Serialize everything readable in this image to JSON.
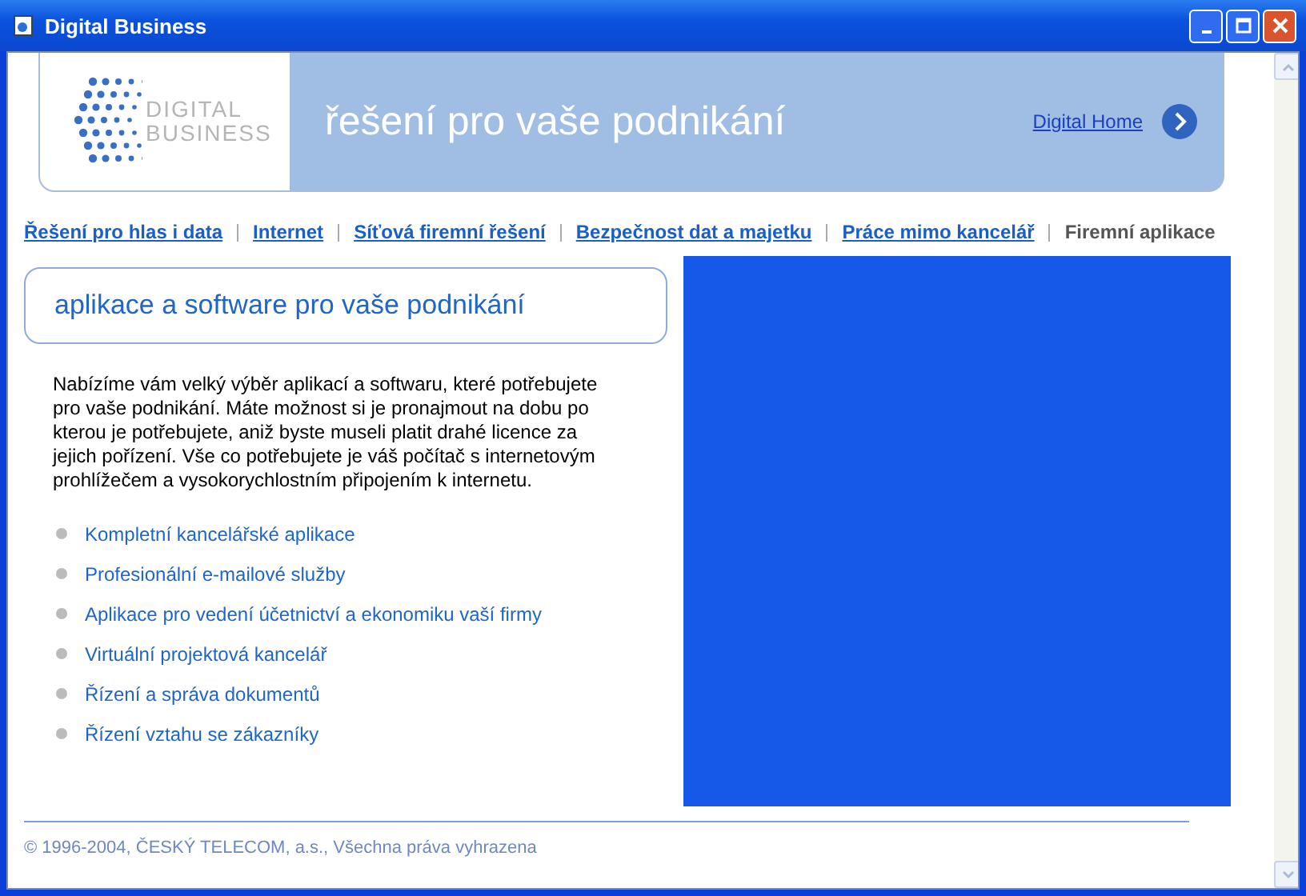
{
  "window": {
    "title": "Digital Business"
  },
  "header": {
    "logo_text": [
      "DIGITAL",
      "BUSINESS"
    ],
    "tagline": "řešení pro vaše podnikání",
    "home_link": "Digital Home"
  },
  "nav": [
    {
      "label": "Řešení pro hlas i data",
      "selected": false
    },
    {
      "label": "Internet",
      "selected": false
    },
    {
      "label": "Síťová firemní řešení",
      "selected": false
    },
    {
      "label": "Bezpečnost dat a majetku",
      "selected": false
    },
    {
      "label": "Práce mimo kancelář",
      "selected": false
    },
    {
      "label": "Firemní aplikace",
      "selected": true
    }
  ],
  "section_title": "aplikace a software pro vaše podnikání",
  "intro": "Nabízíme vám velký výběr aplikací a softwaru, které potřebujete pro vaše podnikání. Máte možnost si je pronajmout na dobu po kterou je potřebujete, aniž byste museli platit drahé licence za jejich pořízení. Vše co potřebujete je váš počítač s internetovým prohlížečem a vysokorychlostním připojením k internetu.",
  "links": [
    "Kompletní kancelářské aplikace",
    "Profesionální e-mailové služby",
    "Aplikace pro vedení účetnictví a ekonomiku vaší firmy",
    "Virtuální projektová kancelář",
    "Řízení a správa dokumentů",
    "Řízení vztahu se zákazníky"
  ],
  "footer": "© 1996-2004, ČESKÝ TELECOM, a.s., Všechna práva vyhrazena"
}
